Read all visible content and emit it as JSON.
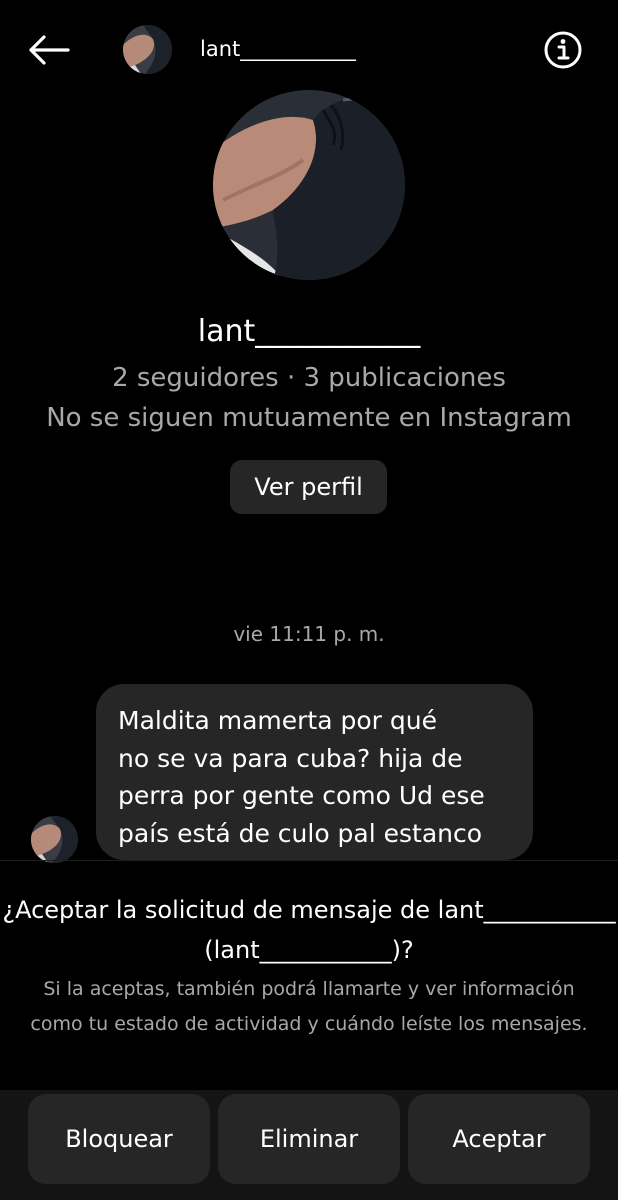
{
  "header": {
    "username": "lant___________",
    "icons": {
      "back": "arrow-left-icon",
      "info": "info-icon"
    }
  },
  "profile": {
    "name": "lant___________",
    "stats": "2 seguidores · 3 publicaciones",
    "mutual": "No se siguen mutuamente en Instagram",
    "view_profile_label": "Ver perfil"
  },
  "conversation": {
    "timestamp": "vie 11:11 p. m.",
    "messages": [
      {
        "text": "Maldita mamerta por qué\nno se va para cuba?  hija de\nperra por gente como Ud ese\npaís está de culo pal estanco"
      }
    ]
  },
  "request": {
    "title": "¿Aceptar la solicitud de mensaje de lant___________ (lant___________)?",
    "description": "Si la aceptas, también podrá llamarte y ver información como tu estado de actividad y cuándo leíste los mensajes."
  },
  "actions": {
    "block": "Bloquear",
    "delete": "Eliminar",
    "accept": "Aceptar"
  },
  "colors": {
    "background": "#000000",
    "surface": "#262626",
    "secondary_text": "#a8a8a8"
  }
}
